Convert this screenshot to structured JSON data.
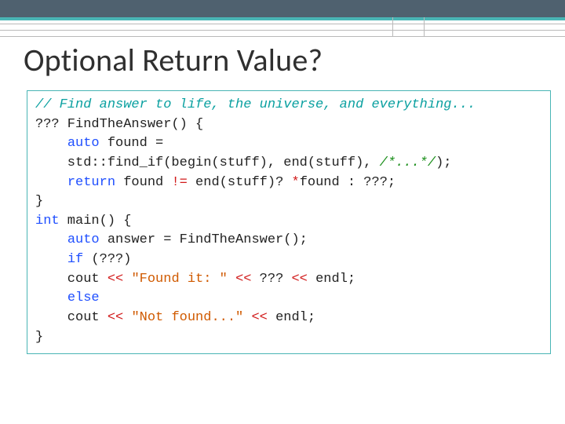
{
  "slide": {
    "title": "Optional Return Value?"
  },
  "code": {
    "l1": "// Find answer to life, the universe, and everything...",
    "l2a": "??? FindTheAnswer() {",
    "l3a": "    ",
    "l3b": "auto",
    "l3c": " found =",
    "l4": "    std::find_if(begin(stuff), end(stuff), ",
    "l4b": "/*...*/",
    "l4c": ");",
    "l5a": "    ",
    "l5b": "return",
    "l5c": " found ",
    "l5d": "!=",
    "l5e": " end(stuff)? ",
    "l5f": "*",
    "l5g": "found : ???;",
    "l6": "}",
    "l7a": "int",
    "l7b": " main() {",
    "l8a": "    ",
    "l8b": "auto",
    "l8c": " answer = FindTheAnswer();",
    "l9a": "    ",
    "l9b": "if",
    "l9c": " (???)",
    "l10a": "    cout ",
    "l10b": "<<",
    "l10c": " ",
    "l10d": "\"Found it: \"",
    "l10e": " ",
    "l10f": "<<",
    "l10g": " ??? ",
    "l10h": "<<",
    "l10i": " endl;",
    "l11a": "    ",
    "l11b": "else",
    "l12a": "    cout ",
    "l12b": "<<",
    "l12c": " ",
    "l12d": "\"Not found...\"",
    "l12e": " ",
    "l12f": "<<",
    "l12g": " endl;",
    "l13": "}"
  }
}
